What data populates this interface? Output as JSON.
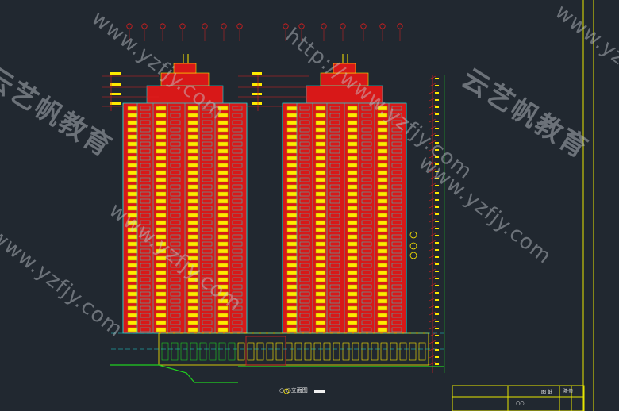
{
  "drawing": {
    "caption": "○-○立面图",
    "title_block": {
      "label_top": "图 纸",
      "label_bottom": "○○",
      "code": "建-施"
    }
  },
  "watermarks": {
    "brand": "云艺帆教育",
    "url": "www.yzfjy.com",
    "url_alt": "http://www.yzfjy.com"
  },
  "colors": {
    "background": "#212830",
    "building_fill": "#d81818",
    "window": "#ffea00",
    "trim": "#20d6d6",
    "dimension": "#e01e1e",
    "frame": "#e6e600",
    "ground": "#20d020"
  }
}
